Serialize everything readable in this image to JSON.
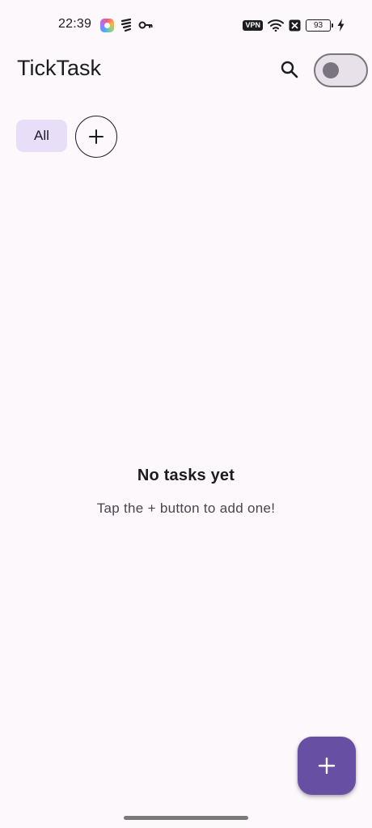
{
  "status_bar": {
    "time": "22:39",
    "vpn_label": "VPN",
    "battery_level": "93",
    "icons": [
      "app-icon",
      "signal-icon",
      "key-icon",
      "wifi-icon",
      "no-sim-icon",
      "battery-icon",
      "charging-icon"
    ]
  },
  "app_bar": {
    "title": "TickTask",
    "search_icon": "search-icon",
    "theme_toggle_on": false
  },
  "categories": {
    "chips": [
      {
        "label": "All",
        "selected": true
      }
    ],
    "add_icon": "plus-icon"
  },
  "empty_state": {
    "title": "No tasks yet",
    "subtitle": "Tap the + button to add one!"
  },
  "fab": {
    "icon": "plus-icon"
  },
  "colors": {
    "background": "#fdf8fc",
    "primary": "#6750a4",
    "chip_selected": "#e8def8",
    "outline": "#79747e",
    "text": "#1c1b1f"
  }
}
